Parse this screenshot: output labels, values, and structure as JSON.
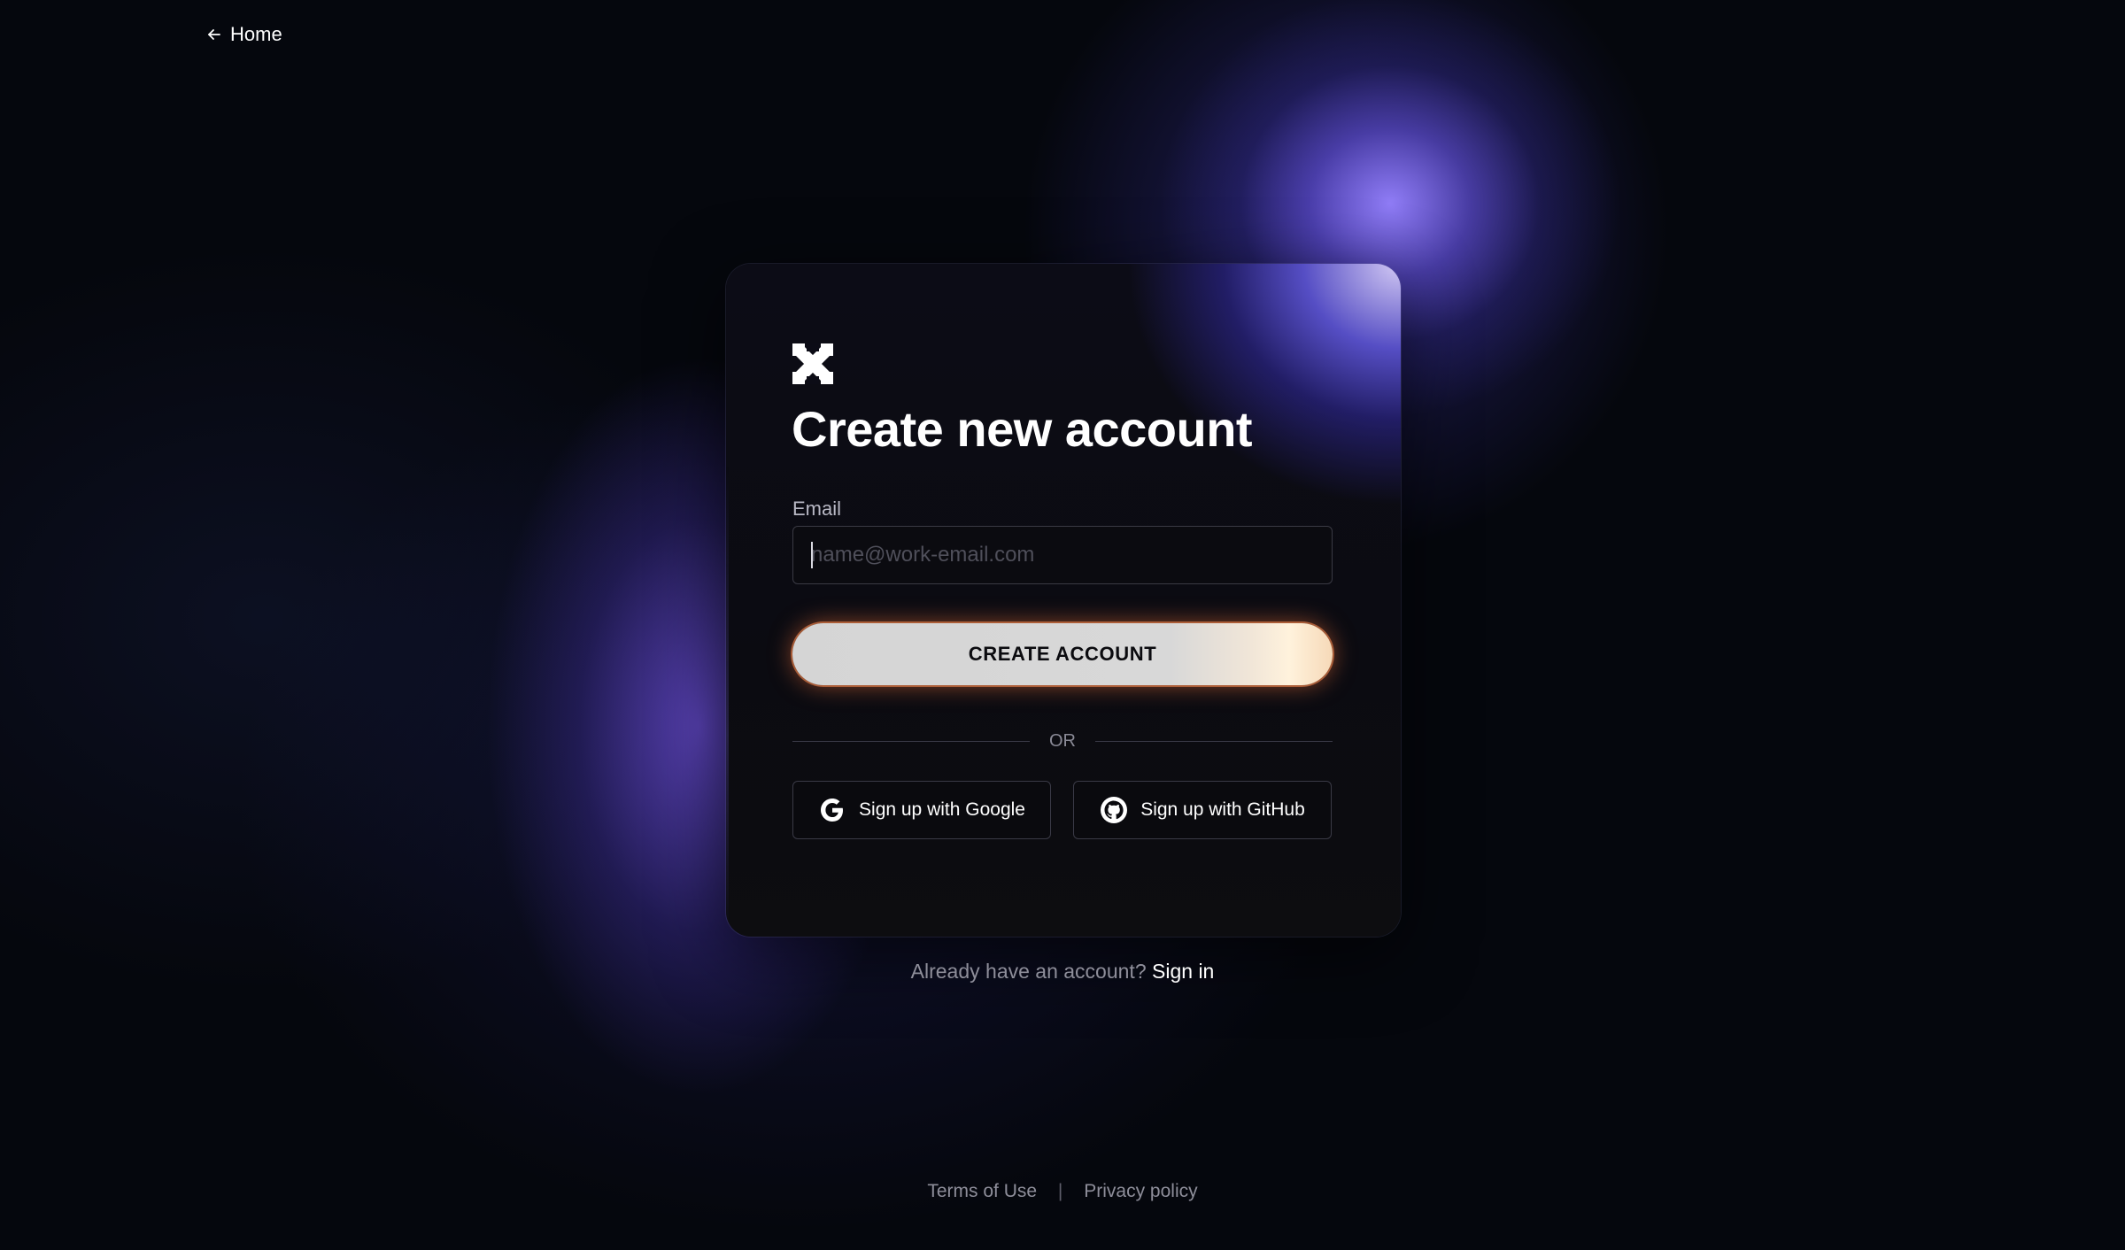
{
  "nav": {
    "home_label": "Home",
    "back_icon": "arrow-left-icon"
  },
  "card": {
    "logo_icon": "brand-logo-icon",
    "title": "Create new account",
    "email_label": "Email",
    "email_value": "",
    "email_placeholder": "name@work-email.com",
    "create_button_label": "CREATE ACCOUNT",
    "divider_label": "OR",
    "google_button_label": "Sign up with Google",
    "google_icon": "google-icon",
    "github_button_label": "Sign up with GitHub",
    "github_icon": "github-icon"
  },
  "signin": {
    "prompt": "Already have an account?",
    "link_label": "Sign in"
  },
  "footer": {
    "terms_label": "Terms of Use",
    "separator": "|",
    "privacy_label": "Privacy policy"
  },
  "colors": {
    "background": "#05070d",
    "accent_glow": "#7a6cff",
    "button_glow": "#ff8a4f"
  }
}
